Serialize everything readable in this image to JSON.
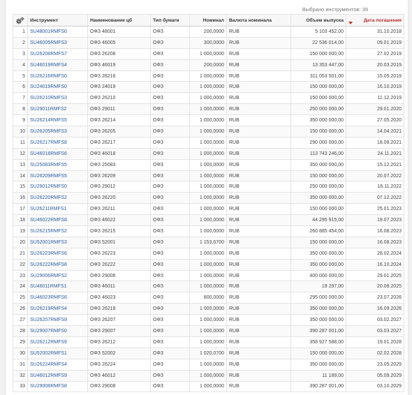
{
  "selected_label": "Выбрано инструментов: 39",
  "columns": {
    "instrument": "Инструмент",
    "name": "Наименование цб",
    "type": "Тип бумаги",
    "nominal": "Номинал",
    "currency": "Валюта номинала",
    "volume": "Объем выпуска",
    "maturity": "Дата погашения"
  },
  "sort": {
    "column": "maturity",
    "direction": "desc"
  },
  "accent_color": "#b52a2a",
  "link_color": "#2a5d9f",
  "rows": [
    {
      "n": "1",
      "code": "SU48001RMFS0",
      "name": "ОФЗ 48001",
      "type": "ОФЗ",
      "nominal": "200,0000",
      "currency": "RUB",
      "volume": "5 103 452,00",
      "date": "31.10.2018"
    },
    {
      "n": "2",
      "code": "SU46005RMFS3",
      "name": "ОФЗ 46005",
      "type": "ОФЗ",
      "nominal": "300,0000",
      "currency": "RUB",
      "volume": "22 536 014,00",
      "date": "09.01.2019"
    },
    {
      "n": "3",
      "code": "SU26208RMFS7",
      "name": "ОФЗ 26208",
      "type": "ОФЗ",
      "nominal": "1 000,0000",
      "currency": "RUB",
      "volume": "150 000 000,00",
      "date": "27.02.2019"
    },
    {
      "n": "4",
      "code": "SU46019RMFS4",
      "name": "ОФЗ 46019",
      "type": "ОФЗ",
      "nominal": "200,0000",
      "currency": "RUB",
      "volume": "13 353 447,00",
      "date": "20.03.2019"
    },
    {
      "n": "5",
      "code": "SU26216RMFS0",
      "name": "ОФЗ 26216",
      "type": "ОФЗ",
      "nominal": "1 000,0000",
      "currency": "RUB",
      "volume": "311 053 501,00",
      "date": "15.05.2019"
    },
    {
      "n": "6",
      "code": "SU24019RMFS0",
      "name": "ОФЗ 24019",
      "type": "ОФЗ",
      "nominal": "1 000,0000",
      "currency": "RUB",
      "volume": "150 000 000,00",
      "date": "16.10.2019"
    },
    {
      "n": "7",
      "code": "SU26210RMFS3",
      "name": "ОФЗ 26210",
      "type": "ОФЗ",
      "nominal": "1 000,0000",
      "currency": "RUB",
      "volume": "150 000 000,00",
      "date": "11.12.2019"
    },
    {
      "n": "8",
      "code": "SU29011RMFS2",
      "name": "ОФЗ 29011",
      "type": "ОФЗ",
      "nominal": "1 000,0000",
      "currency": "RUB",
      "volume": "250 000 000,00",
      "date": "29.01.2020"
    },
    {
      "n": "9",
      "code": "SU26214RMFS5",
      "name": "ОФЗ 26214",
      "type": "ОФЗ",
      "nominal": "1 000,0000",
      "currency": "RUB",
      "volume": "350 000 000,00",
      "date": "27.05.2020"
    },
    {
      "n": "10",
      "code": "SU26205RMFS3",
      "name": "ОФЗ 26205",
      "type": "ОФЗ",
      "nominal": "1 000,0000",
      "currency": "RUB",
      "volume": "150 000 000,00",
      "date": "14.04.2021"
    },
    {
      "n": "11",
      "code": "SU26217RMFS8",
      "name": "ОФЗ 26217",
      "type": "ОФЗ",
      "nominal": "1 000,0000",
      "currency": "RUB",
      "volume": "290 000 000,00",
      "date": "18.08.2021"
    },
    {
      "n": "12",
      "code": "SU46018RMFS6",
      "name": "ОФЗ 46018",
      "type": "ОФЗ",
      "nominal": "1 000,0000",
      "currency": "RUB",
      "volume": "113 743 246,00",
      "date": "24.11.2021"
    },
    {
      "n": "13",
      "code": "SU25083RMFS5",
      "name": "ОФЗ 25083",
      "type": "ОФЗ",
      "nominal": "1 000,0000",
      "currency": "RUB",
      "volume": "350 000 000,00",
      "date": "15.12.2021"
    },
    {
      "n": "14",
      "code": "SU26209RMFS5",
      "name": "ОФЗ 26209",
      "type": "ОФЗ",
      "nominal": "1 000,0000",
      "currency": "RUB",
      "volume": "150 000 000,00",
      "date": "20.07.2022"
    },
    {
      "n": "15",
      "code": "SU29012RMFS0",
      "name": "ОФЗ 29012",
      "type": "ОФЗ",
      "nominal": "1 000,0000",
      "currency": "RUB",
      "volume": "250 000 000,00",
      "date": "16.11.2022"
    },
    {
      "n": "16",
      "code": "SU26220RMFS2",
      "name": "ОФЗ 26220",
      "type": "ОФЗ",
      "nominal": "1 000,0000",
      "currency": "RUB",
      "volume": "350 000 000,00",
      "date": "07.12.2022"
    },
    {
      "n": "17",
      "code": "SU26211RMFS1",
      "name": "ОФЗ 26211",
      "type": "ОФЗ",
      "nominal": "1 000,0000",
      "currency": "RUB",
      "volume": "150 000 000,00",
      "date": "25.01.2023"
    },
    {
      "n": "18",
      "code": "SU46022RMFS8",
      "name": "ОФЗ 46022",
      "type": "ОФЗ",
      "nominal": "1 000,0000",
      "currency": "RUB",
      "volume": "44 295 915,00",
      "date": "19.07.2023"
    },
    {
      "n": "19",
      "code": "SU26215RMFS2",
      "name": "ОФЗ 26215",
      "type": "ОФЗ",
      "nominal": "1 000,0000",
      "currency": "RUB",
      "volume": "260 885 454,00",
      "date": "16.08.2023"
    },
    {
      "n": "20",
      "code": "SU52001RMFS3",
      "name": "ОФЗ 52001",
      "type": "ОФЗ",
      "nominal": "1 153,6700",
      "currency": "RUB",
      "volume": "150 000 000,00",
      "date": "16.08.2023"
    },
    {
      "n": "21",
      "code": "SU26223RMFS6",
      "name": "ОФЗ 26223",
      "type": "ОФЗ",
      "nominal": "1 000,0000",
      "currency": "RUB",
      "volume": "350 000 000,00",
      "date": "28.02.2024"
    },
    {
      "n": "22",
      "code": "SU26222RMFS8",
      "name": "ОФЗ 26222",
      "type": "ОФЗ",
      "nominal": "1 000,0000",
      "currency": "RUB",
      "volume": "350 000 000,00",
      "date": "16.10.2024"
    },
    {
      "n": "23",
      "code": "SU29006RMFS2",
      "name": "ОФЗ 29006",
      "type": "ОФЗ",
      "nominal": "1 000,0000",
      "currency": "RUB",
      "volume": "400 000 000,00",
      "date": "29.01.2025"
    },
    {
      "n": "24",
      "code": "SU46011RMFS1",
      "name": "ОФЗ 46011",
      "type": "ОФЗ",
      "nominal": "1 000,0000",
      "currency": "RUB",
      "volume": "19 297,00",
      "date": "20.08.2025"
    },
    {
      "n": "25",
      "code": "SU46023RMFS6",
      "name": "ОФЗ 46023",
      "type": "ОФЗ",
      "nominal": "800,0000",
      "currency": "RUB",
      "volume": "295 000 000,00",
      "date": "23.07.2026"
    },
    {
      "n": "26",
      "code": "SU26219RMFS4",
      "name": "ОФЗ 26219",
      "type": "ОФЗ",
      "nominal": "1 000,0000",
      "currency": "RUB",
      "volume": "350 000 000,00",
      "date": "16.09.2026"
    },
    {
      "n": "27",
      "code": "SU26207RMFS9",
      "name": "ОФЗ 26207",
      "type": "ОФЗ",
      "nominal": "1 000,0000",
      "currency": "RUB",
      "volume": "350 000 000,00",
      "date": "03.02.2027"
    },
    {
      "n": "28",
      "code": "SU29007RMFS0",
      "name": "ОФЗ 29007",
      "type": "ОФЗ",
      "nominal": "1 000,0000",
      "currency": "RUB",
      "volume": "390 287 001,00",
      "date": "03.03.2027"
    },
    {
      "n": "29",
      "code": "SU26212RMFS9",
      "name": "ОФЗ 26212",
      "type": "ОФЗ",
      "nominal": "1 000,0000",
      "currency": "RUB",
      "volume": "358 927 588,00",
      "date": "19.01.2028"
    },
    {
      "n": "30",
      "code": "SU52002RMFS1",
      "name": "ОФЗ 52002",
      "type": "ОФЗ",
      "nominal": "1 020,0700",
      "currency": "RUB",
      "volume": "150 000 000,00",
      "date": "02.02.2028"
    },
    {
      "n": "31",
      "code": "SU26224RMFS4",
      "name": "ОФЗ 26224",
      "type": "ОФЗ",
      "nominal": "1 000,0000",
      "currency": "RUB",
      "volume": "350 000 000,00",
      "date": "23.05.2029"
    },
    {
      "n": "32",
      "code": "SU46012RMFS9",
      "name": "ОФЗ 46012",
      "type": "ОФЗ",
      "nominal": "1 000,0000",
      "currency": "RUB",
      "volume": "11 189,00",
      "date": "05.09.2029"
    },
    {
      "n": "33",
      "code": "SU29008RMFS8",
      "name": "ОФЗ 29008",
      "type": "ОФЗ",
      "nominal": "1 000,0000",
      "currency": "RUB",
      "volume": "390 287 001,00",
      "date": "03.10.2029"
    }
  ]
}
